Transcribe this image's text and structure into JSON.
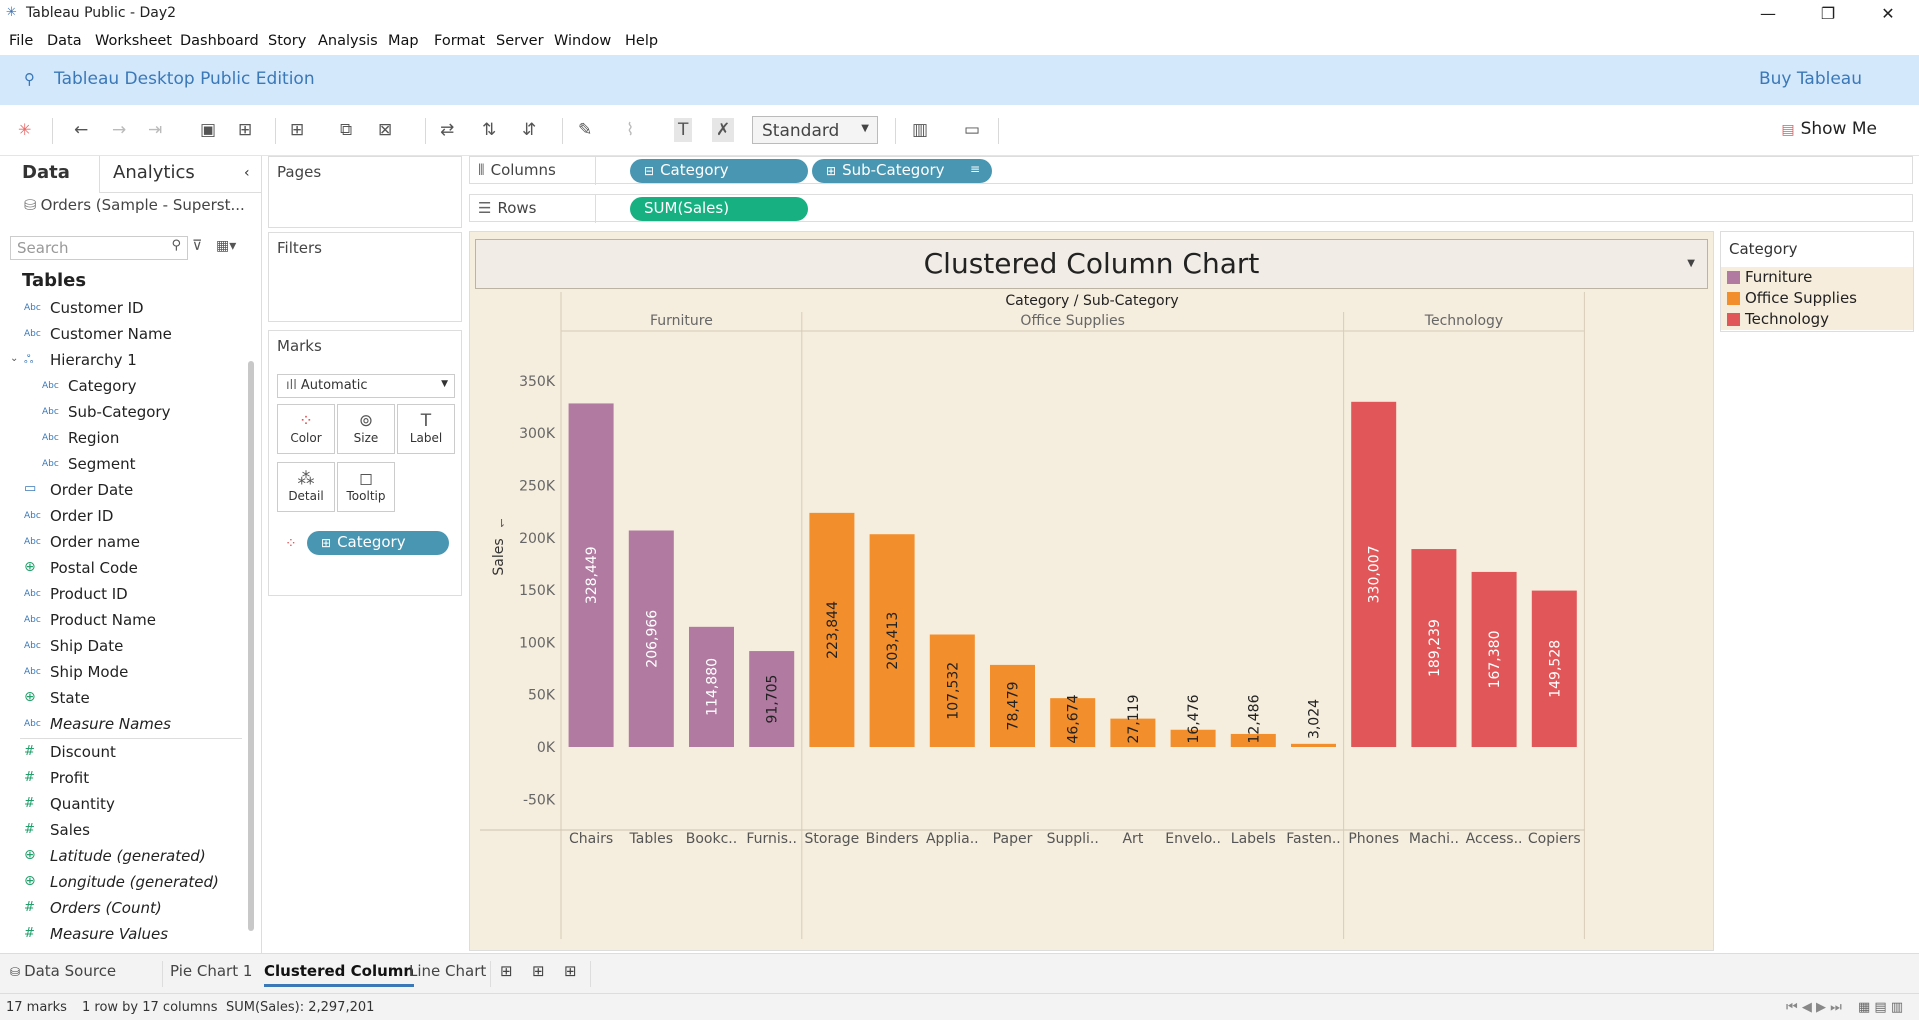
{
  "window": {
    "title": "Tableau Public - Day2"
  },
  "menu": [
    "File",
    "Data",
    "Worksheet",
    "Dashboard",
    "Story",
    "Analysis",
    "Map",
    "Format",
    "Server",
    "Window",
    "Help"
  ],
  "banner": {
    "edition": "Tableau Desktop Public Edition",
    "buy": "Buy Tableau"
  },
  "toolbar": {
    "fit": "Standard",
    "show_me": "Show Me"
  },
  "left_panel": {
    "tab_data": "Data",
    "tab_analytics": "Analytics",
    "datasource": "Orders (Sample - Superst...",
    "search_placeholder": "Search",
    "tables_heading": "Tables",
    "fields": [
      {
        "name": "Customer ID",
        "type": "abc"
      },
      {
        "name": "Customer Name",
        "type": "abc"
      },
      {
        "name": "Hierarchy 1",
        "type": "hier"
      },
      {
        "name": "Category",
        "type": "abc"
      },
      {
        "name": "Sub-Category",
        "type": "abc"
      },
      {
        "name": "Region",
        "type": "abc"
      },
      {
        "name": "Segment",
        "type": "abc"
      },
      {
        "name": "Order Date",
        "type": "cal"
      },
      {
        "name": "Order ID",
        "type": "abc"
      },
      {
        "name": "Order name",
        "type": "abc"
      },
      {
        "name": "Postal Code",
        "type": "geo"
      },
      {
        "name": "Product ID",
        "type": "abc"
      },
      {
        "name": "Product Name",
        "type": "abc"
      },
      {
        "name": "Ship Date",
        "type": "abc"
      },
      {
        "name": "Ship Mode",
        "type": "abc"
      },
      {
        "name": "State",
        "type": "geo"
      },
      {
        "name": "Measure Names",
        "type": "abc"
      },
      {
        "name": "Discount",
        "type": "hash"
      },
      {
        "name": "Profit",
        "type": "hash"
      },
      {
        "name": "Quantity",
        "type": "hash"
      },
      {
        "name": "Sales",
        "type": "hash"
      },
      {
        "name": "Latitude (generated)",
        "type": "geo"
      },
      {
        "name": "Longitude (generated)",
        "type": "geo"
      },
      {
        "name": "Orders (Count)",
        "type": "hash"
      },
      {
        "name": "Measure Values",
        "type": "hash"
      }
    ]
  },
  "cards": {
    "pages": "Pages",
    "filters": "Filters",
    "marks": "Marks",
    "mark_type": "Automatic",
    "mark_buttons": [
      "Color",
      "Size",
      "Label",
      "Detail",
      "Tooltip"
    ],
    "color_pill": "Category"
  },
  "shelves": {
    "columns_label": "Columns",
    "rows_label": "Rows",
    "columns_pills": [
      "Category",
      "Sub-Category"
    ],
    "rows_pills": [
      "SUM(Sales)"
    ]
  },
  "legend": {
    "title": "Category",
    "items": [
      {
        "label": "Furniture",
        "color": "#b07aa1"
      },
      {
        "label": "Office Supplies",
        "color": "#f28e2b"
      },
      {
        "label": "Technology",
        "color": "#e15759"
      }
    ]
  },
  "chart_data": {
    "type": "bar",
    "title": "Clustered Column Chart",
    "header_title": "Category / Sub-Category",
    "ylabel": "Sales",
    "ylim": [
      -50000,
      350000
    ],
    "yticks": [
      -50000,
      0,
      50000,
      100000,
      150000,
      200000,
      250000,
      300000,
      350000
    ],
    "ytick_labels": [
      "-50K",
      "0K",
      "50K",
      "100K",
      "150K",
      "200K",
      "250K",
      "300K",
      "350K"
    ],
    "groups": [
      {
        "name": "Furniture",
        "color": "#b07aa1",
        "categories": [
          "Chairs",
          "Tables",
          "Bookc..",
          "Furnis.."
        ],
        "values": [
          328449,
          206966,
          114880,
          91705
        ],
        "labels": [
          "328,449",
          "206,966",
          "114,880",
          "91,705"
        ]
      },
      {
        "name": "Office Supplies",
        "color": "#f28e2b",
        "categories": [
          "Storage",
          "Binders",
          "Applia..",
          "Paper",
          "Suppli..",
          "Art",
          "Envelo..",
          "Labels",
          "Fasten.."
        ],
        "values": [
          223844,
          203413,
          107532,
          78479,
          46674,
          27119,
          16476,
          12486,
          3024
        ],
        "labels": [
          "223,844",
          "203,413",
          "107,532",
          "78,479",
          "46,674",
          "27,119",
          "16,476",
          "12,486",
          "3,024"
        ]
      },
      {
        "name": "Technology",
        "color": "#e15759",
        "categories": [
          "Phones",
          "Machi..",
          "Access..",
          "Copiers"
        ],
        "values": [
          330007,
          189239,
          167380,
          149528
        ],
        "labels": [
          "330,007",
          "189,239",
          "167,380",
          "149,528"
        ]
      }
    ]
  },
  "sheet_tabs": {
    "data_source": "Data Source",
    "tabs": [
      "Pie Chart 1",
      "Clustered Column",
      "Line Chart"
    ]
  },
  "status": {
    "marks": "17 marks",
    "dims": "1 row by 17 columns",
    "sum": "SUM(Sales): 2,297,201"
  }
}
